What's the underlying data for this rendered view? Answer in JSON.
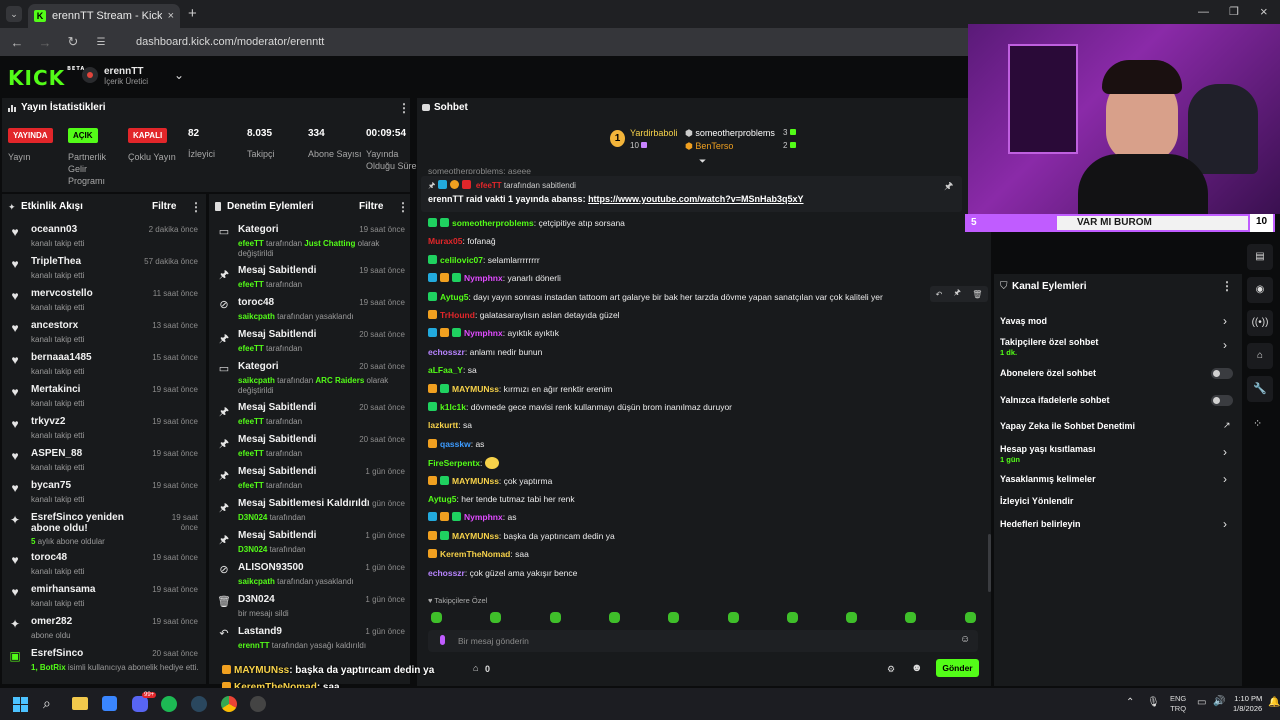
{
  "browser": {
    "tab_title": "erennTT Stream - Kick Dashboard",
    "url": "dashboard.kick.com/moderator/erenntt"
  },
  "header": {
    "logo": "KICK",
    "logo_tag": "BETA",
    "channel_name": "erennTT",
    "channel_role": "İçerik Üretici"
  },
  "stats": {
    "title": "Yayın İstatistikleri",
    "items": [
      {
        "badge": "YAYINDA",
        "label": "Yayın",
        "badge_color": "#e2262a"
      },
      {
        "badge": "AÇIK",
        "label": "Partnerlik Gelir Programı",
        "badge_color": "#53fc18"
      },
      {
        "badge": "KAPALI",
        "label": "Çoklu Yayın",
        "badge_color": "#e2262a"
      },
      {
        "value": "82",
        "label": "İzleyici"
      },
      {
        "value": "8.035",
        "label": "Takipçi"
      },
      {
        "value": "334",
        "label": "Abone Sayısı"
      },
      {
        "value": "00:09:54",
        "label": "Yayında Olduğu Süre"
      }
    ]
  },
  "activity": {
    "title": "Etkinlik Akışı",
    "filter": "Filtre",
    "items": [
      {
        "name": "oceann03",
        "sub": "kanalı takip etti",
        "time": "2 dakika önce",
        "icon": "heart-icon"
      },
      {
        "name": "TripleThea",
        "sub": "kanalı takip etti",
        "time": "57 dakika önce",
        "icon": "heart-icon"
      },
      {
        "name": "mervcostello",
        "sub": "kanalı takip etti",
        "time": "11 saat önce",
        "icon": "heart-icon"
      },
      {
        "name": "ancestorx",
        "sub": "kanalı takip etti",
        "time": "13 saat önce",
        "icon": "heart-icon"
      },
      {
        "name": "bernaaa1485",
        "sub": "kanalı takip etti",
        "time": "15 saat önce",
        "icon": "heart-icon"
      },
      {
        "name": "Mertakinci",
        "sub": "kanalı takip etti",
        "time": "19 saat önce",
        "icon": "heart-icon"
      },
      {
        "name": "trkyvz2",
        "sub": "kanalı takip etti",
        "time": "19 saat önce",
        "icon": "heart-icon"
      },
      {
        "name": "ASPEN_88",
        "sub": "kanalı takip etti",
        "time": "19 saat önce",
        "icon": "heart-icon"
      },
      {
        "name": "bycan75",
        "sub": "kanalı takip etti",
        "time": "19 saat önce",
        "icon": "heart-icon"
      },
      {
        "name": "EsrefSinco yeniden abone oldu!",
        "sub_green": "5",
        "sub": " aylık abone oldular",
        "time": "19 saat önce",
        "icon": "star-icon"
      },
      {
        "name": "toroc48",
        "sub": "kanalı takip etti",
        "time": "19 saat önce",
        "icon": "heart-icon"
      },
      {
        "name": "emirhansama",
        "sub": "kanalı takip etti",
        "time": "19 saat önce",
        "icon": "heart-icon"
      },
      {
        "name": "omer282",
        "sub": "abone oldu",
        "time": "19 saat önce",
        "icon": "star-icon"
      },
      {
        "name": "EsrefSinco",
        "sub_green": "1, BotRix",
        "sub": " isimli kullanıcıya abonelik hediye etti.",
        "time": "20 saat önce",
        "icon": "gift-icon"
      }
    ]
  },
  "moderation": {
    "title": "Denetim Eylemleri",
    "filter": "Filtre",
    "items": [
      {
        "title": "Kategori",
        "time": "19 saat önce",
        "icon": "category-icon",
        "line1_green": "efeeTT",
        "line1": " tarafından ",
        "line1_green2": "Just Chatting",
        "line1_end": " olarak",
        "line2": "değiştirildi"
      },
      {
        "title": "Mesaj Sabitlendi",
        "time": "19 saat önce",
        "icon": "pin-icon",
        "line1_green": "efeeTT",
        "line1": " tarafından"
      },
      {
        "title": "toroc48",
        "time": "19 saat önce",
        "icon": "ban-icon",
        "line1_green": "saikcpath",
        "line1": " tarafından yasaklandı"
      },
      {
        "title": "Mesaj Sabitlendi",
        "time": "20 saat önce",
        "icon": "pin-icon",
        "line1_green": "efeeTT",
        "line1": " tarafından"
      },
      {
        "title": "Kategori",
        "time": "20 saat önce",
        "icon": "category-icon",
        "line1_green": "saikcpath",
        "line1": " tarafından ",
        "line1_green2": "ARC Raiders",
        "line1_end": " olarak",
        "line2": "değiştirildi"
      },
      {
        "title": "Mesaj Sabitlendi",
        "time": "20 saat önce",
        "icon": "pin-icon",
        "line1_green": "efeeTT",
        "line1": " tarafından"
      },
      {
        "title": "Mesaj Sabitlendi",
        "time": "20 saat önce",
        "icon": "pin-icon",
        "line1_green": "efeeTT",
        "line1": " tarafından"
      },
      {
        "title": "Mesaj Sabitlendi",
        "time": "1 gün önce",
        "icon": "pin-icon",
        "line1_green": "efeeTT",
        "line1": " tarafından"
      },
      {
        "title": "Mesaj Sabitlemesi Kaldırıldı",
        "time": "1 gün önce",
        "icon": "pin-icon",
        "line1_green": "D3N024",
        "line1": " tarafından"
      },
      {
        "title": "Mesaj Sabitlendi",
        "time": "1 gün önce",
        "icon": "pin-icon",
        "line1_green": "D3N024",
        "line1": " tarafından"
      },
      {
        "title": "ALISON93500",
        "time": "1 gün önce",
        "icon": "ban-icon",
        "line1_green": "saikcpath",
        "line1": " tarafından yasaklandı"
      },
      {
        "title": "D3N024",
        "time": "1 gün önce",
        "icon": "trash-icon",
        "line1": "bir mesajı sildi"
      },
      {
        "title": "Lastand9",
        "time": "1 gün önce",
        "icon": "undo-icon",
        "line1_green": "erennTT",
        "line1": " tarafından yasağı kaldırıldı"
      }
    ]
  },
  "chat": {
    "title": "Sohbet",
    "top_gifters": [
      {
        "name": "Yardirbaboli",
        "count": "10"
      },
      {
        "name": "someotherproblems",
        "count": "3"
      },
      {
        "name": "BenTerso",
        "count": "2"
      }
    ],
    "pinned_by_user": "efeeTT",
    "pinned_by_text": " tarafından sabitlendi",
    "pinned_message": "erennTT raid vakti 1 yayında abanss: ",
    "pinned_link": "https://www.youtube.com/watch?v=MSnHab3q5xY",
    "partial_top": "someotherproblems: aseee",
    "messages": [
      {
        "user": "someotherproblems",
        "color": "#53fc18",
        "text": "çetçipitiye atıp sorsana",
        "badges": [
          "#1fd160",
          "#1fd160"
        ]
      },
      {
        "user": "Murax05",
        "color": "#e2262a",
        "text": "fofanağ",
        "badges": []
      },
      {
        "user": "celilovic07",
        "color": "#53fc18",
        "text": "selamlarrrrrrrr",
        "badges": [
          "#1fd160"
        ]
      },
      {
        "user": "Nymphnx",
        "color": "#e04bff",
        "text": "yanarlı dönerli",
        "badges": [
          "#22aadd",
          "#f0a020",
          "#1fd160"
        ]
      },
      {
        "user": "Aytug5",
        "color": "#53fc18",
        "text": "dayı yayın sonrası instadan tattoom art galarye bir bak her tarzda dövme yapan sanatçılan var çok kaliteli yer",
        "badges": [
          "#1fd160"
        ]
      },
      {
        "user": "TrHound",
        "color": "#e2262a",
        "text": "galatasaraylısın aslan detayıda güzel",
        "badges": [
          "#f0a020"
        ]
      },
      {
        "user": "Nymphnx",
        "color": "#e04bff",
        "text": "ayıktık ayıktık",
        "badges": [
          "#22aadd",
          "#f0a020",
          "#1fd160"
        ]
      },
      {
        "user": "echosszr",
        "color": "#b884ff",
        "text": "anlamı nedir bunun",
        "badges": []
      },
      {
        "user": "aLFaa_Y",
        "color": "#53fc18",
        "text": "sa",
        "badges": []
      },
      {
        "user": "MAYMUNss",
        "color": "#f7d24a",
        "text": "kırmızı en ağır renktir erenim",
        "badges": [
          "#f0a020",
          "#1fd160"
        ]
      },
      {
        "user": "k1lc1k",
        "color": "#53fc18",
        "text": "dövmede gece mavisi renk kullanmayı düşün brom inanılmaz duruyor",
        "badges": [
          "#1fd160"
        ]
      },
      {
        "user": "lazkurtt",
        "color": "#f7d24a",
        "text": "sa",
        "badges": []
      },
      {
        "user": "qasskw",
        "color": "#3d9cff",
        "text": "as",
        "badges": [
          "#f0a020"
        ]
      },
      {
        "user": "FireSerpentx",
        "color": "#53fc18",
        "text": "",
        "emote": true,
        "badges": []
      },
      {
        "user": "MAYMUNss",
        "color": "#f7d24a",
        "text": "çok yaptırma",
        "badges": [
          "#f0a020",
          "#1fd160"
        ]
      },
      {
        "user": "Aytug5",
        "color": "#53fc18",
        "text": "her tende tutmaz tabi her renk",
        "badges": []
      },
      {
        "user": "Nymphnx",
        "color": "#e04bff",
        "text": "as",
        "badges": [
          "#22aadd",
          "#f0a020",
          "#1fd160"
        ]
      },
      {
        "user": "MAYMUNss",
        "color": "#f7d24a",
        "text": "başka da yaptırıcam dedin ya",
        "badges": [
          "#f0a020",
          "#1fd160"
        ]
      },
      {
        "user": "KeremTheNomad",
        "color": "#f7d24a",
        "text": "saa",
        "badges": [
          "#f0a020"
        ]
      },
      {
        "user": "echosszr",
        "color": "#b884ff",
        "text": "çok güzel ama yakışır bence",
        "badges": []
      }
    ],
    "emote_section": "Takipçilere Özel",
    "input_placeholder": "Bir mesaj gönderin",
    "send": "Gönder",
    "footer_count": "0"
  },
  "channel_actions": {
    "title": "Kanal Eylemleri",
    "items": [
      {
        "label": "Yavaş mod",
        "kind": "chevron"
      },
      {
        "label": "Takipçilere özel sohbet",
        "sub": "1 dk.",
        "kind": "chevron"
      },
      {
        "label": "Abonelere özel sohbet",
        "kind": "toggle"
      },
      {
        "label": "Yalnızca ifadelerle sohbet",
        "kind": "toggle"
      },
      {
        "label": "Yapay Zeka ile Sohbet Denetimi",
        "kind": "external"
      },
      {
        "label": "Hesap yaşı kısıtlaması",
        "sub": "1 gün",
        "kind": "chevron"
      },
      {
        "label": "Yasaklanmış kelimeler",
        "kind": "chevron"
      },
      {
        "label": "İzleyici Yönlendir",
        "kind": "none"
      },
      {
        "label": "Hedefleri belirleyin",
        "kind": "chevron"
      }
    ]
  },
  "overlay": {
    "bar_left": "5",
    "bar_center": "VAR MI BUROM",
    "bar_right": "10",
    "subtitles": [
      {
        "user": "MAYMUNss",
        "text": ": başka da yaptırıcam dedin ya"
      },
      {
        "user": "KeremTheNomad",
        "text": ": saa"
      },
      {
        "user": "echosszr",
        "text": ": çok güzel ama yakışır bence"
      }
    ]
  },
  "taskbar": {
    "lang_top": "ENG",
    "lang_bottom": "TRQ",
    "time": "1:10 PM",
    "date": "1/8/2026",
    "badge_count": "99+"
  }
}
